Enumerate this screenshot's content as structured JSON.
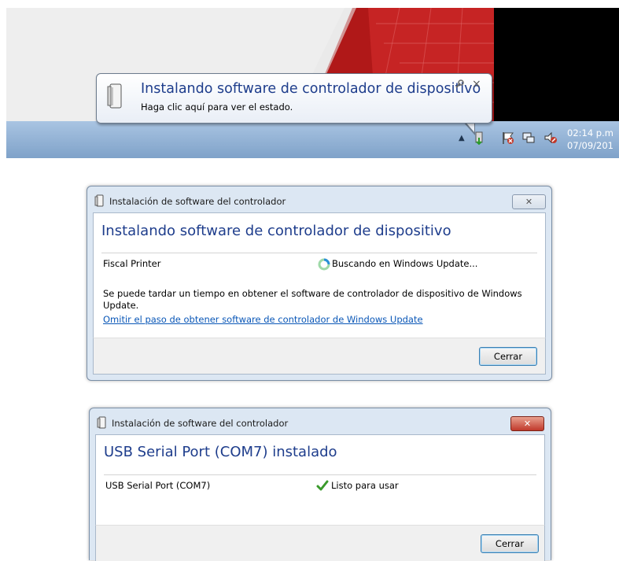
{
  "balloon": {
    "title": "Instalando software de controlador de dispositivo",
    "subtitle": "Haga clic aquí para ver el estado.",
    "close_glyph": "×"
  },
  "taskbar": {
    "show_hidden_glyph": "▲",
    "clock_time": "02:14 p.m",
    "clock_date": "07/09/201",
    "tray_icons": [
      "device-install-icon",
      "action-center-flag-icon",
      "network-icon",
      "volume-muted-icon"
    ]
  },
  "dialog1": {
    "window_title": "Instalación de software del controlador",
    "close_glyph": "✕",
    "heading": "Instalando software de controlador de dispositivo",
    "device_name": "Fiscal Printer",
    "device_status": "Buscando en Windows Update...",
    "info_text": "Se puede tardar un tiempo en obtener el software de controlador de dispositivo de Windows Update.",
    "skip_link": "Omitir el paso de obtener software de controlador de Windows Update",
    "close_button": "Cerrar"
  },
  "dialog2": {
    "window_title": "Instalación de software del controlador",
    "close_glyph": "✕",
    "heading": "USB Serial Port (COM7) instalado",
    "device_name": "USB Serial Port (COM7)",
    "device_status": "Listo para usar",
    "close_button": "Cerrar"
  },
  "colors": {
    "heading_blue": "#1e3d8c",
    "link_blue": "#0a57b7",
    "close_red": "#c0392b",
    "success_green": "#3a9a2b"
  }
}
